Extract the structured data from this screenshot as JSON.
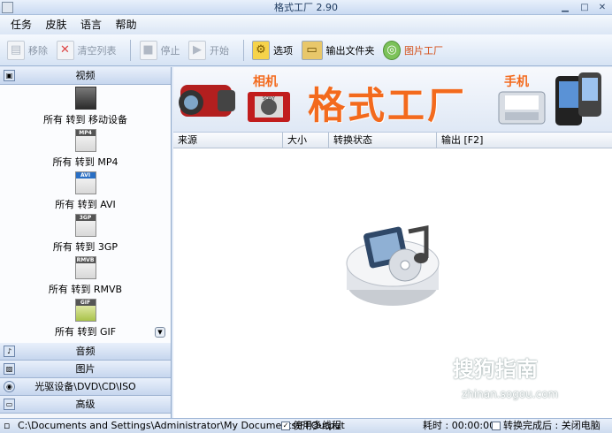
{
  "window": {
    "title": "格式工厂 2.90"
  },
  "menu": {
    "items": [
      "任务",
      "皮肤",
      "语言",
      "帮助"
    ]
  },
  "toolbar": {
    "remove_label": "移除",
    "clear_label": "清空列表",
    "stop_label": "停止",
    "start_label": "开始",
    "options_label": "选项",
    "output_folder_label": "输出文件夹",
    "factory_label": "图片工厂"
  },
  "sidebar": {
    "video_header": "视频",
    "video_items": [
      {
        "icon_tag": "",
        "label": "所有 转到 移动设备"
      },
      {
        "icon_tag": "MP4",
        "label": "所有 转到 MP4"
      },
      {
        "icon_tag": "AVI",
        "label": "所有 转到 AVI"
      },
      {
        "icon_tag": "3GP",
        "label": "所有 转到 3GP"
      },
      {
        "icon_tag": "RMVB",
        "label": "所有 转到 RMVB"
      },
      {
        "icon_tag": "GIF",
        "label": "所有 转到 GIF"
      }
    ],
    "audio_header": "音频",
    "image_header": "图片",
    "disc_header": "光驱设备\\DVD\\CD\\ISO",
    "advanced_header": "高级"
  },
  "banner": {
    "camera_tag": "相机",
    "brand": "格式工厂",
    "phone_tag": "手机",
    "camera_brand": "SONY"
  },
  "table": {
    "col_source": "来源",
    "col_size": "大小",
    "col_status": "转换状态",
    "col_output": "输出 [F2]"
  },
  "statusbar": {
    "path": "C:\\Documents and Settings\\Administrator\\My Documents\\FFOutput",
    "multithread_label": "使用多线程",
    "elapsed": "耗时 : 00:00:00",
    "after_convert": "转换完成后 : 关闭电脑"
  },
  "watermark": {
    "main": "搜狗指南",
    "sub": "zhinan.sogou.com"
  },
  "colors": {
    "accent": "#f36a1d",
    "frame": "#9fb6d6"
  }
}
